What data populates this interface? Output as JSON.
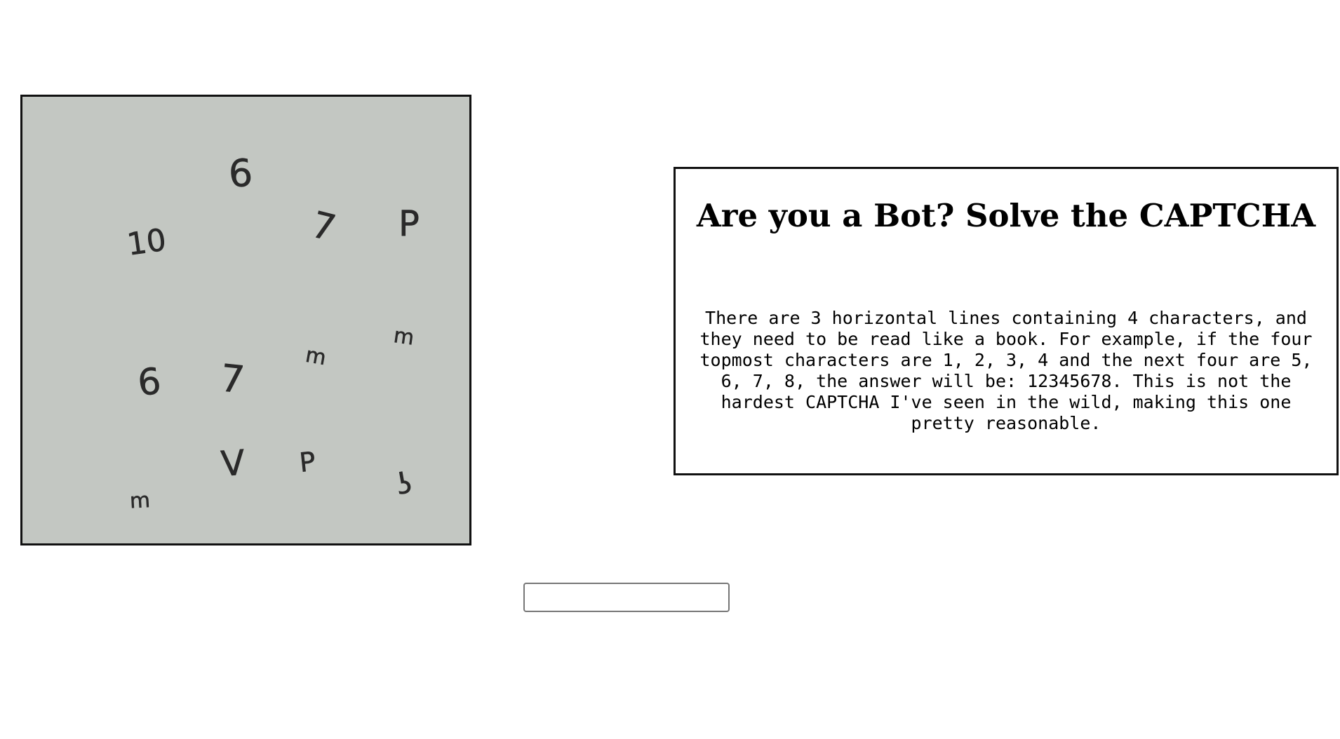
{
  "captcha": {
    "characters": [
      "6",
      "10",
      "7",
      "P",
      "m",
      "m",
      "6",
      "7",
      "V",
      "P",
      "m",
      "ʖ"
    ]
  },
  "panel": {
    "title": "Are you a Bot? Solve the CAPTCHA",
    "instructions": "There are 3 horizontal lines containing 4 characters, and they need to be read like a book. For example, if the four topmost characters are 1, 2, 3, 4 and the next four are 5, 6, 7, 8, the answer will be: 12345678. This is not the hardest CAPTCHA I've seen in the wild, making this one pretty reasonable."
  },
  "answer": {
    "value": "",
    "placeholder": ""
  },
  "colors": {
    "captcha_background": "#c3c7c2",
    "border": "#111111"
  }
}
